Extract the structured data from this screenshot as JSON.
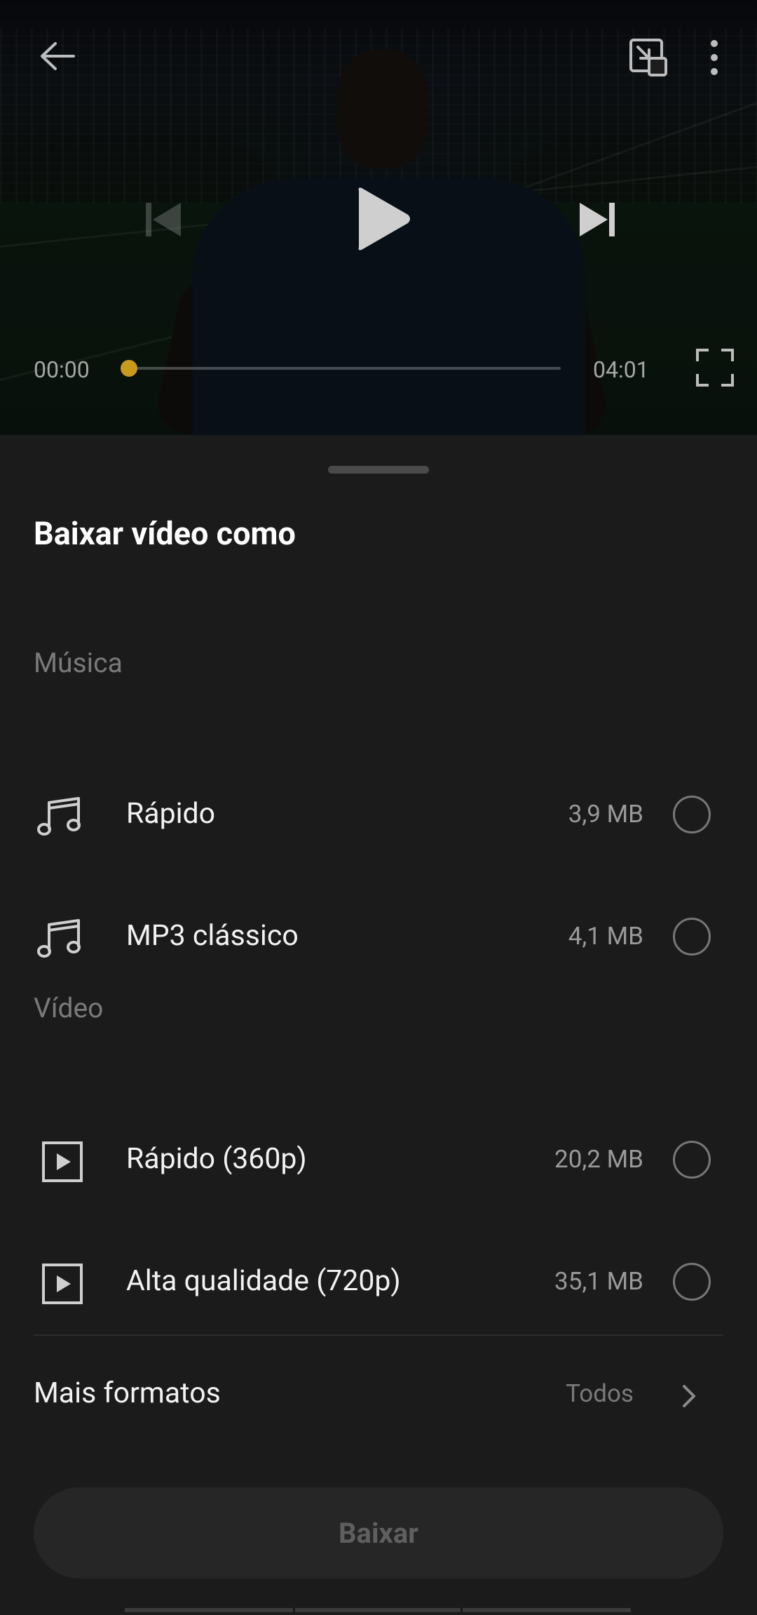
{
  "player": {
    "time_current": "00:00",
    "time_total": "04:01",
    "progress": 0.0,
    "accent_color": "#c89a1e",
    "icons": [
      "back-arrow-icon",
      "minimize-player-icon",
      "more-vert-icon",
      "skip-previous-icon",
      "play-icon",
      "skip-next-icon",
      "fullscreen-icon"
    ]
  },
  "sheet": {
    "title": "Baixar vídeo como",
    "sections": [
      {
        "label": "Música",
        "options": [
          {
            "label": "Rápido",
            "size": "3,9 MB",
            "icon": "music-note-icon"
          },
          {
            "label": "MP3 clássico",
            "size": "4,1 MB",
            "icon": "music-note-icon"
          }
        ]
      },
      {
        "label": "Vídeo",
        "options": [
          {
            "label": "Rápido (360p)",
            "size": "20,2 MB",
            "icon": "video-play-icon"
          },
          {
            "label": "Alta qualidade (720p)",
            "size": "35,1 MB",
            "icon": "video-play-icon"
          }
        ]
      }
    ],
    "more_formats": {
      "label": "Mais formatos",
      "value": "Todos"
    },
    "download_button": "Baixar"
  }
}
